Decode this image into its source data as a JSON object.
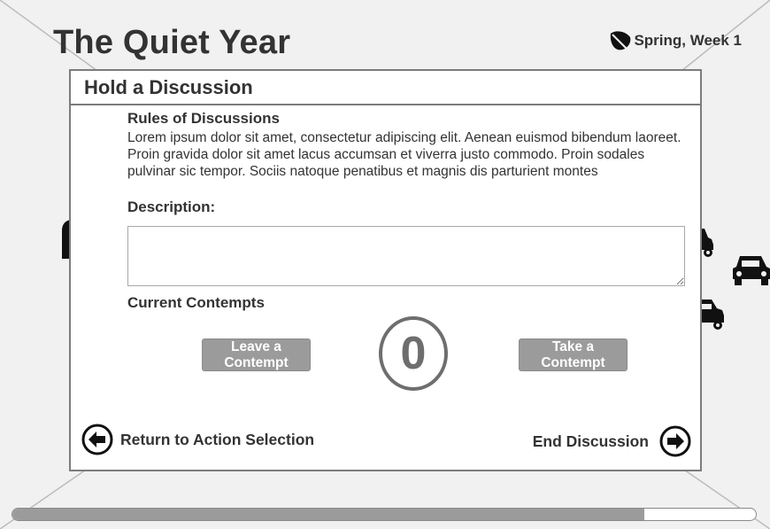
{
  "app": {
    "title": "The Quiet Year",
    "season": "Spring, Week 1"
  },
  "modal": {
    "title": "Hold a Discussion",
    "rules_title": "Rules of Discussions",
    "rules_text": "Lorem ipsum dolor sit amet, consectetur adipiscing elit. Aenean euismod bibendum laoreet. Proin gravida dolor sit amet lacus accumsan et viverra justo commodo. Proin sodales pulvinar sic tempor. Sociis natoque penatibus et magnis dis parturient montes",
    "description_label": "Description:",
    "description_value": "",
    "contempts_label": "Current Contempts",
    "leave_button": "Leave a Contempt",
    "take_button": "Take a Contempt",
    "contempt_count": "0",
    "return_label": "Return to Action Selection",
    "end_label": "End Discussion"
  },
  "progress": {
    "fraction": 0.85
  },
  "icons": {
    "season": "leaf-icon",
    "return": "arrow-left-circle-icon",
    "end": "arrow-right-circle-icon",
    "background": [
      "car-icon",
      "car-icon",
      "car-icon"
    ]
  },
  "colors": {
    "background": "#f1f1f1",
    "border": "#7c7c7c",
    "button": "#9b9b9b",
    "text": "#333333"
  }
}
